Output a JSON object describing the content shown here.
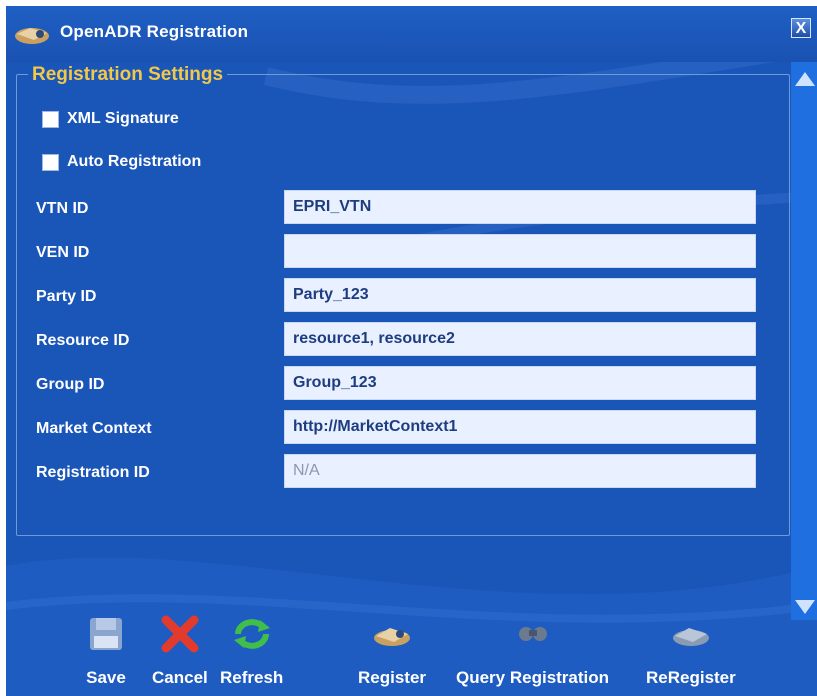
{
  "window": {
    "title": "OpenADR Registration",
    "close_label": "X"
  },
  "group": {
    "title": "Registration Settings"
  },
  "options": {
    "xml_signature_label": "XML Signature",
    "xml_signature_checked": false,
    "auto_registration_label": "Auto Registration",
    "auto_registration_checked": false
  },
  "fields": [
    {
      "label": "VTN ID",
      "value": "EPRI_VTN"
    },
    {
      "label": "VEN ID",
      "value": ""
    },
    {
      "label": "Party ID",
      "value": "Party_123"
    },
    {
      "label": "Resource ID",
      "value": "resource1, resource2"
    },
    {
      "label": "Group ID",
      "value": "Group_123"
    },
    {
      "label": "Market Context",
      "value": "http://MarketContext1"
    },
    {
      "label": "Registration ID",
      "value": "N/A"
    }
  ],
  "toolbar": {
    "save": "Save",
    "cancel": "Cancel",
    "refresh": "Refresh",
    "register": "Register",
    "query_registration": "Query Registration",
    "reregister": "ReRegister"
  },
  "icons": {
    "title": "registration-icon",
    "save": "floppy-disk-icon",
    "cancel": "red-x-icon",
    "refresh": "green-arrows-icon",
    "register": "handshake-icon",
    "query": "binoculars-icon",
    "reregister": "handshake-gray-icon"
  },
  "colors": {
    "window_bg": "#1a55b8",
    "group_title": "#f2c84a",
    "field_bg": "#e9f0ff",
    "field_text": "#1e3d80",
    "scrollbar": "#1f6fe0"
  }
}
